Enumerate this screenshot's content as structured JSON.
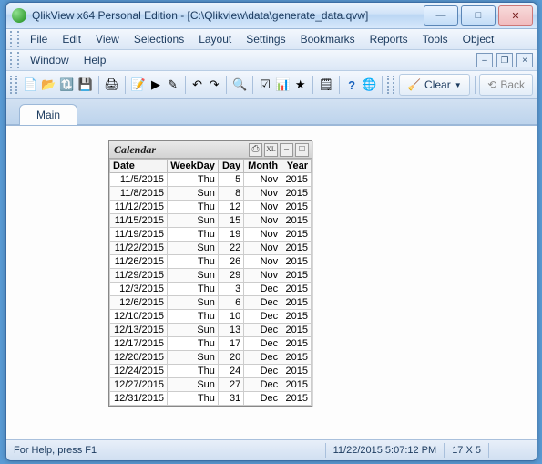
{
  "title": "QlikView x64 Personal Edition - [C:\\Qlikview\\data\\generate_data.qvw]",
  "menu": {
    "row1": [
      "File",
      "Edit",
      "View",
      "Selections",
      "Layout",
      "Settings",
      "Bookmarks",
      "Reports",
      "Tools",
      "Object"
    ],
    "row2": [
      "Window",
      "Help"
    ]
  },
  "toolbar": {
    "clear": "Clear",
    "back": "Back"
  },
  "tabs": {
    "main": "Main"
  },
  "calendar": {
    "caption": "Calendar",
    "columns": [
      "Date",
      "WeekDay",
      "Day",
      "Month",
      "Year"
    ],
    "rows": [
      [
        "11/5/2015",
        "Thu",
        "5",
        "Nov",
        "2015"
      ],
      [
        "11/8/2015",
        "Sun",
        "8",
        "Nov",
        "2015"
      ],
      [
        "11/12/2015",
        "Thu",
        "12",
        "Nov",
        "2015"
      ],
      [
        "11/15/2015",
        "Sun",
        "15",
        "Nov",
        "2015"
      ],
      [
        "11/19/2015",
        "Thu",
        "19",
        "Nov",
        "2015"
      ],
      [
        "11/22/2015",
        "Sun",
        "22",
        "Nov",
        "2015"
      ],
      [
        "11/26/2015",
        "Thu",
        "26",
        "Nov",
        "2015"
      ],
      [
        "11/29/2015",
        "Sun",
        "29",
        "Nov",
        "2015"
      ],
      [
        "12/3/2015",
        "Thu",
        "3",
        "Dec",
        "2015"
      ],
      [
        "12/6/2015",
        "Sun",
        "6",
        "Dec",
        "2015"
      ],
      [
        "12/10/2015",
        "Thu",
        "10",
        "Dec",
        "2015"
      ],
      [
        "12/13/2015",
        "Sun",
        "13",
        "Dec",
        "2015"
      ],
      [
        "12/17/2015",
        "Thu",
        "17",
        "Dec",
        "2015"
      ],
      [
        "12/20/2015",
        "Sun",
        "20",
        "Dec",
        "2015"
      ],
      [
        "12/24/2015",
        "Thu",
        "24",
        "Dec",
        "2015"
      ],
      [
        "12/27/2015",
        "Sun",
        "27",
        "Dec",
        "2015"
      ],
      [
        "12/31/2015",
        "Thu",
        "31",
        "Dec",
        "2015"
      ]
    ]
  },
  "status": {
    "help": "For Help, press F1",
    "datetime": "11/22/2015 5:07:12 PM",
    "dims": "17 X 5"
  },
  "chart_data": {
    "type": "table",
    "title": "Calendar",
    "columns": [
      "Date",
      "WeekDay",
      "Day",
      "Month",
      "Year"
    ],
    "rows": [
      [
        "11/5/2015",
        "Thu",
        5,
        "Nov",
        2015
      ],
      [
        "11/8/2015",
        "Sun",
        8,
        "Nov",
        2015
      ],
      [
        "11/12/2015",
        "Thu",
        12,
        "Nov",
        2015
      ],
      [
        "11/15/2015",
        "Sun",
        15,
        "Nov",
        2015
      ],
      [
        "11/19/2015",
        "Thu",
        19,
        "Nov",
        2015
      ],
      [
        "11/22/2015",
        "Sun",
        22,
        "Nov",
        2015
      ],
      [
        "11/26/2015",
        "Thu",
        26,
        "Nov",
        2015
      ],
      [
        "11/29/2015",
        "Sun",
        29,
        "Nov",
        2015
      ],
      [
        "12/3/2015",
        "Thu",
        3,
        "Dec",
        2015
      ],
      [
        "12/6/2015",
        "Sun",
        6,
        "Dec",
        2015
      ],
      [
        "12/10/2015",
        "Thu",
        10,
        "Dec",
        2015
      ],
      [
        "12/13/2015",
        "Sun",
        13,
        "Dec",
        2015
      ],
      [
        "12/17/2015",
        "Thu",
        17,
        "Dec",
        2015
      ],
      [
        "12/20/2015",
        "Sun",
        20,
        "Dec",
        2015
      ],
      [
        "12/24/2015",
        "Thu",
        24,
        "Dec",
        2015
      ],
      [
        "12/27/2015",
        "Sun",
        27,
        "Dec",
        2015
      ],
      [
        "12/31/2015",
        "Thu",
        31,
        "Dec",
        2015
      ]
    ]
  }
}
